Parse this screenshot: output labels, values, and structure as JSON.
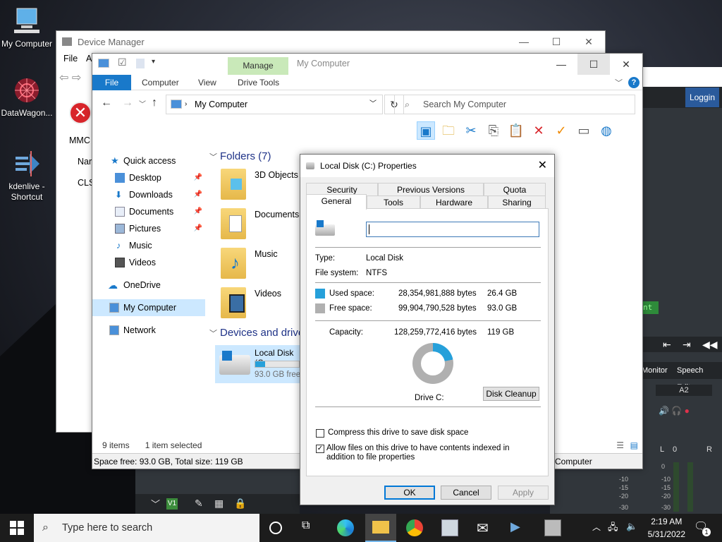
{
  "desktop": {
    "icons": [
      {
        "label": "My Computer"
      },
      {
        "label": "DataWagon..."
      },
      {
        "label": "kdenlive - Shortcut"
      }
    ]
  },
  "kdenlive": {
    "logging": "Loggin",
    "monitor": "Monitor",
    "speech_editor": "Speech Editor",
    "track_a2": "A2",
    "track_v1": "V1",
    "partial_label": "nt",
    "lr_left": "L",
    "lr_right": "R",
    "lr_value": "0",
    "db_left": [
      "0",
      "-10",
      "-15",
      "-20",
      "-30"
    ],
    "db_right": [
      "-10",
      "-15",
      "-20",
      "-30"
    ]
  },
  "device_manager": {
    "title": "Device Manager",
    "menu_file": "File",
    "menu_a": "A",
    "mmc": "MMC",
    "nar": "Nar",
    "cls": "CLS"
  },
  "explorer": {
    "title": "My Computer",
    "manage_tab": "Manage",
    "tabs": {
      "file": "File",
      "computer": "Computer",
      "view": "View",
      "drive_tools": "Drive Tools"
    },
    "address": "My Computer",
    "search_placeholder": "Search My Computer",
    "nav": [
      {
        "label": "Quick access"
      },
      {
        "label": "Desktop"
      },
      {
        "label": "Downloads"
      },
      {
        "label": "Documents"
      },
      {
        "label": "Pictures"
      },
      {
        "label": "Music"
      },
      {
        "label": "Videos"
      },
      {
        "label": "OneDrive"
      },
      {
        "label": "My Computer"
      },
      {
        "label": "Network"
      }
    ],
    "folders_header": "Folders (7)",
    "folders": [
      "3D Objects",
      "Documents",
      "Music",
      "Videos"
    ],
    "devices_header": "Devices and drive",
    "drive": {
      "name": "Local Disk (C",
      "free": "93.0 GB free",
      "used_fraction": 0.22
    },
    "items_count": "9 items",
    "selected": "1 item selected",
    "statusbar": "Space free: 93.0 GB, Total size: 119 GB",
    "statusbar_right": "Computer"
  },
  "properties": {
    "title": "Local Disk (C:) Properties",
    "tabs_row1": [
      "Security",
      "Previous Versions",
      "Quota"
    ],
    "tabs_row2": [
      "General",
      "Tools",
      "Hardware",
      "Sharing"
    ],
    "type_label": "Type:",
    "type_value": "Local Disk",
    "fs_label": "File system:",
    "fs_value": "NTFS",
    "used_label": "Used space:",
    "used_bytes": "28,354,981,888 bytes",
    "used_gb": "26.4 GB",
    "free_label": "Free space:",
    "free_bytes": "99,904,790,528 bytes",
    "free_gb": "93.0 GB",
    "capacity_label": "Capacity:",
    "capacity_bytes": "128,259,772,416 bytes",
    "capacity_gb": "119 GB",
    "drive_label": "Drive C:",
    "disk_cleanup": "Disk Cleanup",
    "compress_label": "Compress this drive to save disk space",
    "index_label": "Allow files on this drive to have contents indexed in addition to file properties",
    "ok": "OK",
    "cancel": "Cancel",
    "apply": "Apply",
    "used_fraction": 0.22,
    "colors": {
      "used": "#26a0da",
      "free": "#b0b0b0"
    }
  },
  "taskbar": {
    "search_placeholder": "Type here to search",
    "time": "2:19 AM",
    "date": "5/31/2022",
    "notif_count": "1"
  }
}
